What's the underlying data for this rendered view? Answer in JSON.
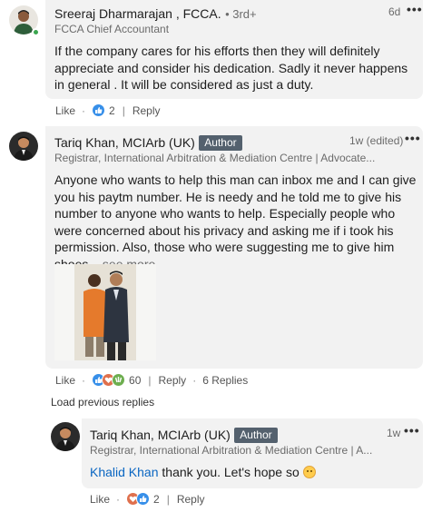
{
  "comments": [
    {
      "author": "Sreeraj Dharmarajan , FCCA.",
      "degree": "• 3rd+",
      "headline": "FCCA Chief Accountant",
      "time": "6d",
      "text": "If the company cares for his efforts then they will definitely appreciate and consider his dedication. Sadly it never happens in general . It will be considered as just a duty.",
      "actions": {
        "like": "Like",
        "reactions": "2",
        "reply": "Reply"
      }
    },
    {
      "author": "Tariq Khan, MCIArb (UK)",
      "badge": "Author",
      "headline": "Registrar, International Arbitration & Mediation Centre | Advocate...",
      "time": "1w (edited)",
      "text": "Anyone who wants to help this man can inbox me and I can give you his paytm number. He is needy and he told me to give his number to anyone who wants to help. Especially people who were concerned about his privacy and asking me if i took his permission. Also, those who were suggesting me to give him shoes",
      "see_more": "...see more",
      "actions": {
        "like": "Like",
        "reactions": "60",
        "reply": "Reply",
        "replies": "6 Replies"
      }
    }
  ],
  "load_previous": "Load previous replies",
  "reply": {
    "author": "Tariq Khan, MCIArb (UK)",
    "badge": "Author",
    "headline": "Registrar, International Arbitration & Mediation Centre | A...",
    "time": "1w",
    "mention": "Khalid Khan",
    "text": " thank you. Let's hope so ",
    "emoji": "smiling-face-emoji",
    "actions": {
      "like": "Like",
      "reactions": "2",
      "reply": "Reply"
    }
  },
  "colors": {
    "bubble": "#f2f2f2",
    "link": "#0a66c2",
    "badge": "#54616e",
    "online": "#3aa64f"
  }
}
